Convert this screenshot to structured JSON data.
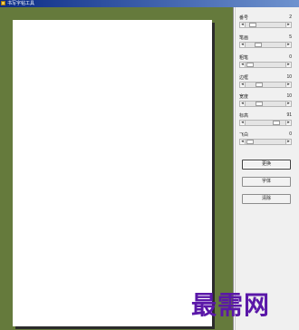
{
  "window": {
    "title": "书写字帖工具"
  },
  "panel": {
    "sliders": [
      {
        "label": "番号",
        "value": "2",
        "position": 0.1
      },
      {
        "label": "笔画",
        "value": "5",
        "position": 0.25
      },
      {
        "label": "粗笔",
        "value": "0",
        "position": 0.0
      },
      {
        "label": "边框",
        "value": "10",
        "position": 0.3
      },
      {
        "label": "宽度",
        "value": "10",
        "position": 0.3
      },
      {
        "label": "标高",
        "value": "91",
        "position": 0.85
      },
      {
        "label": "飞白",
        "value": "0",
        "position": 0.0
      }
    ],
    "buttons": {
      "apply_label": "更换",
      "font_label": "字体",
      "clear_label": "清除"
    }
  },
  "watermark": {
    "text": "最需网"
  }
}
